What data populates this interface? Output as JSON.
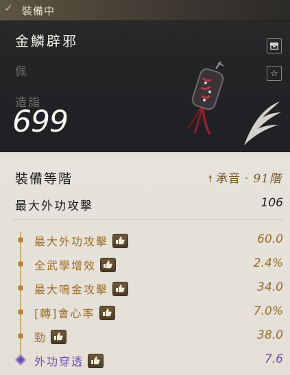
{
  "header": {
    "equip_status": "裝備中",
    "item_name": "金鱗辟邪",
    "slot_type": "佩",
    "craft_label": "造詣",
    "craft_score": "699"
  },
  "grade": {
    "label": "裝備等階",
    "name": "承音",
    "separator": "·",
    "level": "91階"
  },
  "primary_stat": {
    "label": "最大外功攻擊",
    "value": "106"
  },
  "stats": [
    {
      "label": "最大外功攻擊",
      "value": "60.0"
    },
    {
      "label": "全武學增效",
      "value": "2.4%"
    },
    {
      "label": "最大鳴金攻擊",
      "value": "34.0"
    },
    {
      "label": "[轉]會心率",
      "value": "7.0%"
    },
    {
      "label": "勁",
      "value": "38.0"
    },
    {
      "label": "外功穿透",
      "value": "7.6"
    }
  ],
  "colors": {
    "stat_gold": "#a06d27",
    "special_purple": "#6b4fb0",
    "header_bg": "#232428",
    "panel_bg": "#e6e2db"
  },
  "icons": {
    "equip_status": "check-icon",
    "header_buttons": [
      "storage-icon",
      "star-icon"
    ],
    "stat_tag": "thumbs-up-icon",
    "grade_arrow": "up-arrow-icon"
  }
}
